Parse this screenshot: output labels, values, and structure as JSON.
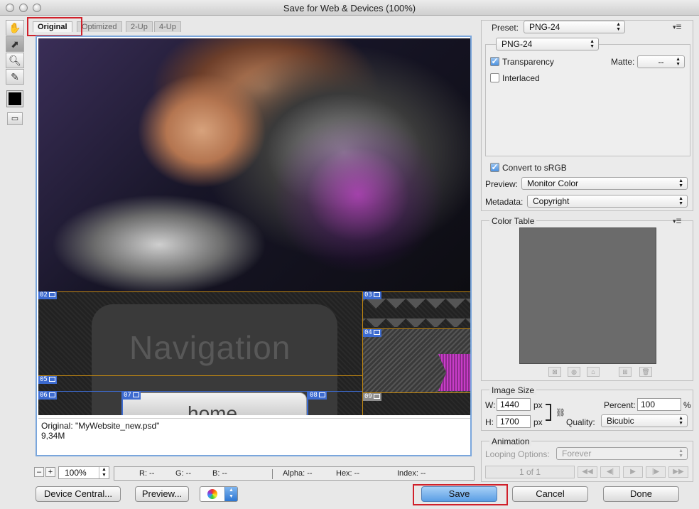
{
  "window": {
    "title": "Save for Web & Devices (100%)"
  },
  "tools": [
    "hand-icon",
    "slice-select-icon",
    "zoom-icon",
    "eyedropper-icon"
  ],
  "eyedropper_color": "#000000",
  "tabs": [
    {
      "label": "Original",
      "active": true
    },
    {
      "label": "Optimized",
      "active": false
    },
    {
      "label": "2-Up",
      "active": false
    },
    {
      "label": "4-Up",
      "active": false
    }
  ],
  "preview": {
    "nav_text": "Navigation",
    "home_text": "home",
    "slices": [
      "02",
      "03",
      "04",
      "05",
      "06",
      "07",
      "08",
      "09"
    ],
    "info_line1": "Original: \"MyWebsite_new.psd\"",
    "info_line2": "9,34M"
  },
  "statusbar": {
    "zoom_minus": "–",
    "zoom_plus": "+",
    "zoom": "100%",
    "r": "R: --",
    "g": "G: --",
    "b": "B: --",
    "alpha": "Alpha: --",
    "hex": "Hex: --",
    "index": "Index: --"
  },
  "buttons": {
    "device_central": "Device Central...",
    "preview": "Preview...",
    "save": "Save",
    "cancel": "Cancel",
    "done": "Done"
  },
  "settings": {
    "preset_label": "Preset:",
    "preset_value": "PNG-24",
    "format_value": "PNG-24",
    "transparency_label": "Transparency",
    "transparency_checked": true,
    "matte_label": "Matte:",
    "matte_value": "--",
    "interlaced_label": "Interlaced",
    "interlaced_checked": false,
    "convert_srgb_label": "Convert to sRGB",
    "convert_srgb_checked": true,
    "preview_label": "Preview:",
    "preview_value": "Monitor Color",
    "metadata_label": "Metadata:",
    "metadata_value": "Copyright"
  },
  "color_table": {
    "title": "Color Table"
  },
  "image_size": {
    "title": "Image Size",
    "w_label": "W:",
    "w_value": "1440",
    "h_label": "H:",
    "h_value": "1700",
    "unit": "px",
    "percent_label": "Percent:",
    "percent_value": "100",
    "percent_unit": "%",
    "quality_label": "Quality:",
    "quality_value": "Bicubic"
  },
  "animation": {
    "title": "Animation",
    "looping_label": "Looping Options:",
    "looping_value": "Forever",
    "frame_counter": "1 of 1"
  }
}
